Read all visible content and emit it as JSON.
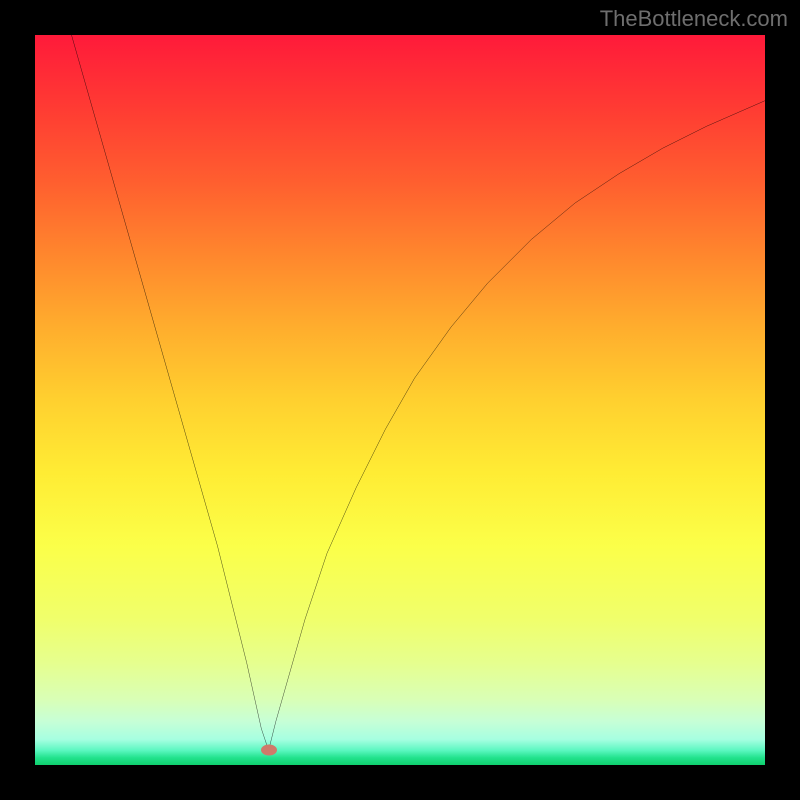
{
  "attribution": "TheBottleneck.com",
  "colors": {
    "frame": "#000000",
    "curve": "#000000",
    "marker": "#cf7a6a",
    "gradient_top": "#ff1a3a",
    "gradient_bottom": "#0fd06e"
  },
  "chart_data": {
    "type": "line",
    "title": "",
    "xlabel": "",
    "ylabel": "",
    "xlim": [
      0,
      100
    ],
    "ylim": [
      0,
      100
    ],
    "grid": false,
    "legend": false,
    "annotations": [],
    "marker": {
      "x": 32,
      "y": 2
    },
    "series": [
      {
        "name": "curve",
        "x": [
          5,
          7,
          9,
          11,
          13,
          15,
          17,
          19,
          21,
          23,
          25,
          27,
          29,
          31,
          32,
          33,
          35,
          37,
          40,
          44,
          48,
          52,
          57,
          62,
          68,
          74,
          80,
          86,
          92,
          100
        ],
        "y": [
          100,
          93,
          86,
          79,
          72,
          65,
          58,
          51,
          44,
          37,
          30,
          22,
          14,
          5,
          2,
          6,
          13,
          20,
          29,
          38,
          46,
          53,
          60,
          66,
          72,
          77,
          81,
          84.5,
          87.5,
          91
        ]
      }
    ]
  }
}
